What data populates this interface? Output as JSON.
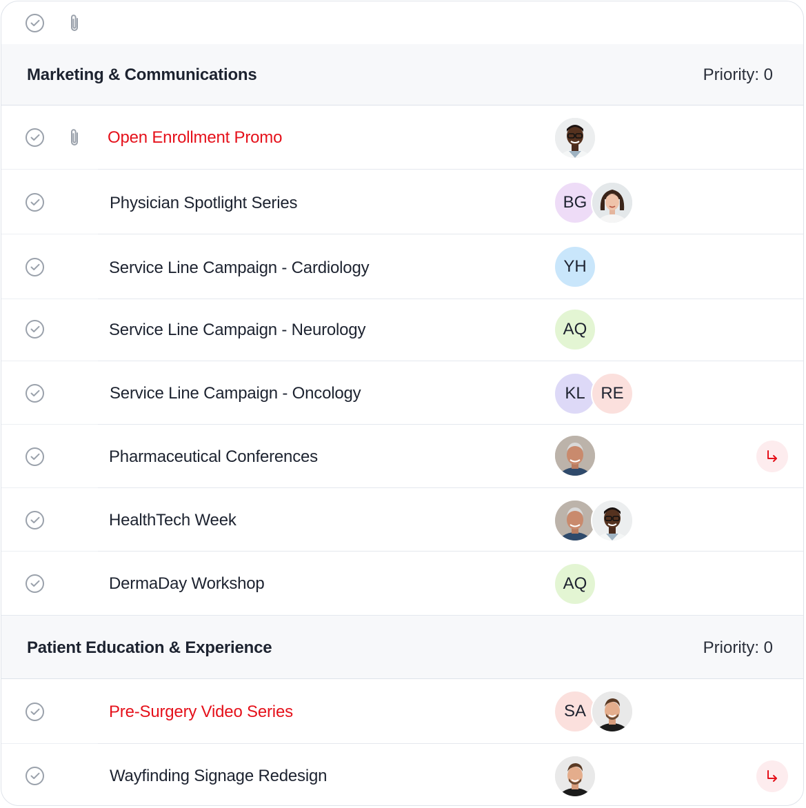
{
  "toolbar": {
    "icons": [
      "check-circle-icon",
      "paperclip-icon"
    ]
  },
  "colors": {
    "overdue": "#e5111b",
    "subtask_accent": "#e5111b",
    "section_bg": "#f7f8fa",
    "avatar_bg": {
      "BG": "#eedcf7",
      "YH": "#c9e6fb",
      "AQ": "#e3f5d3",
      "KL": "#ddd9f7",
      "RE": "#fbe0dd",
      "SA": "#fbe0dd"
    }
  },
  "sections": [
    {
      "title": "Marketing & Communications",
      "priority": "Priority: 0",
      "tasks": [
        {
          "title": "Open Enrollment Promo",
          "overdue": true,
          "has_attachment": true,
          "assignees": [
            "photo-man-glasses-avatar"
          ],
          "has_subtask_link": false
        },
        {
          "title": "Physician Spotlight Series",
          "overdue": false,
          "assignees": [
            "BG",
            "photo-woman-avatar"
          ],
          "has_subtask_link": false
        },
        {
          "title": "Service Line Campaign - Cardiology",
          "overdue": false,
          "assignees": [
            "YH"
          ],
          "has_subtask_link": false
        },
        {
          "title": "Service Line Campaign - Neurology",
          "overdue": false,
          "assignees": [
            "AQ"
          ],
          "has_subtask_link": false
        },
        {
          "title": "Service Line Campaign - Oncology",
          "overdue": false,
          "assignees": [
            "KL",
            "RE"
          ],
          "has_subtask_link": false
        },
        {
          "title": "Pharmaceutical Conferences",
          "overdue": false,
          "assignees": [
            "photo-older-man-avatar"
          ],
          "has_subtask_link": true
        },
        {
          "title": "HealthTech Week",
          "overdue": false,
          "assignees": [
            "photo-older-man-avatar",
            "photo-man-glasses-avatar"
          ],
          "has_subtask_link": false
        },
        {
          "title": "DermaDay Workshop",
          "overdue": false,
          "assignees": [
            "AQ"
          ],
          "has_subtask_link": false
        }
      ]
    },
    {
      "title": "Patient Education & Experience",
      "priority": "Priority: 0",
      "tasks": [
        {
          "title": "Pre-Surgery Video Series",
          "overdue": true,
          "assignees": [
            "SA",
            "photo-smiling-man-avatar"
          ],
          "has_subtask_link": false
        },
        {
          "title": "Wayfinding Signage Redesign",
          "overdue": false,
          "assignees": [
            "photo-smiling-man-avatar"
          ],
          "has_subtask_link": true
        }
      ]
    }
  ]
}
